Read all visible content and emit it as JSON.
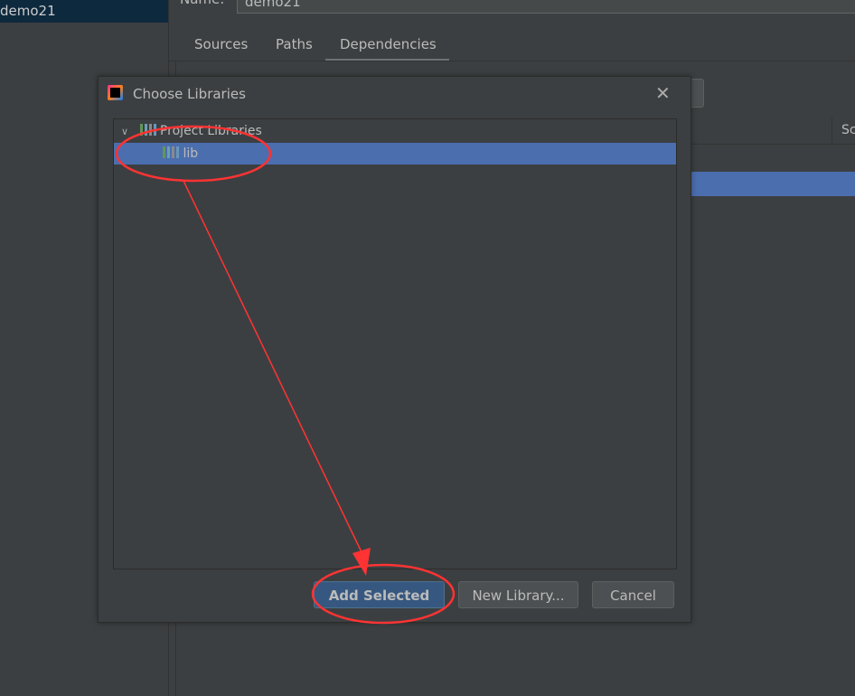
{
  "sidebar": {
    "selected_item": "demo21"
  },
  "module": {
    "name_label": "Name:",
    "name_value": "demo21"
  },
  "tabs": [
    {
      "label": "Sources"
    },
    {
      "label": "Paths"
    },
    {
      "label": "Dependencies",
      "active": true
    }
  ],
  "right_table": {
    "column_partial": "Sc"
  },
  "dialog": {
    "title": "Choose Libraries",
    "tree": {
      "group": "Project Libraries",
      "items": [
        {
          "label": "lib",
          "selected": true
        }
      ]
    },
    "buttons": {
      "add": "Add Selected",
      "new_library": "New Library...",
      "cancel": "Cancel"
    }
  },
  "annotation_color": "#ff3333"
}
